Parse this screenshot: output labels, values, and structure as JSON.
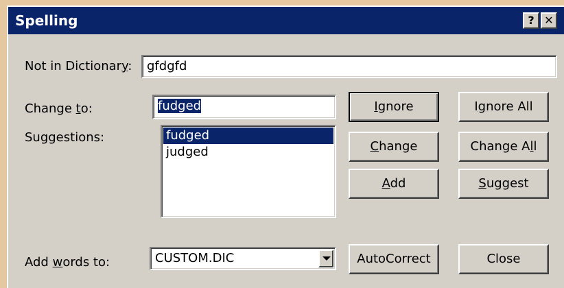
{
  "dialog": {
    "title": "Spelling",
    "help_button": "?",
    "close_button": "✕"
  },
  "not_in_dictionary": {
    "label_pre": "Not in Dictionar",
    "label_u": "y",
    "label_post": ":",
    "value": "gfdgfd"
  },
  "change_to": {
    "label_pre": "Change ",
    "label_u": "t",
    "label_post": "o:",
    "value": "fudged"
  },
  "suggestions": {
    "label": "Suggestions:",
    "items": [
      "fudged",
      "judged"
    ],
    "selected_index": 0
  },
  "add_words_to": {
    "label_pre": "Add ",
    "label_u": "w",
    "label_post": "ords to:",
    "value": "CUSTOM.DIC"
  },
  "buttons": {
    "ignore": {
      "u": "I",
      "rest": "gnore"
    },
    "ignore_all": {
      "pre": "I",
      "u": "g",
      "rest": "nore All"
    },
    "change": {
      "u": "C",
      "rest": "hange"
    },
    "change_all": {
      "pre": "Change A",
      "u": "l",
      "rest": "l"
    },
    "add": {
      "u": "A",
      "rest": "dd"
    },
    "suggest": {
      "u": "S",
      "rest": "uggest"
    },
    "autocorrect": "AutoCorrect",
    "close": "Close"
  }
}
